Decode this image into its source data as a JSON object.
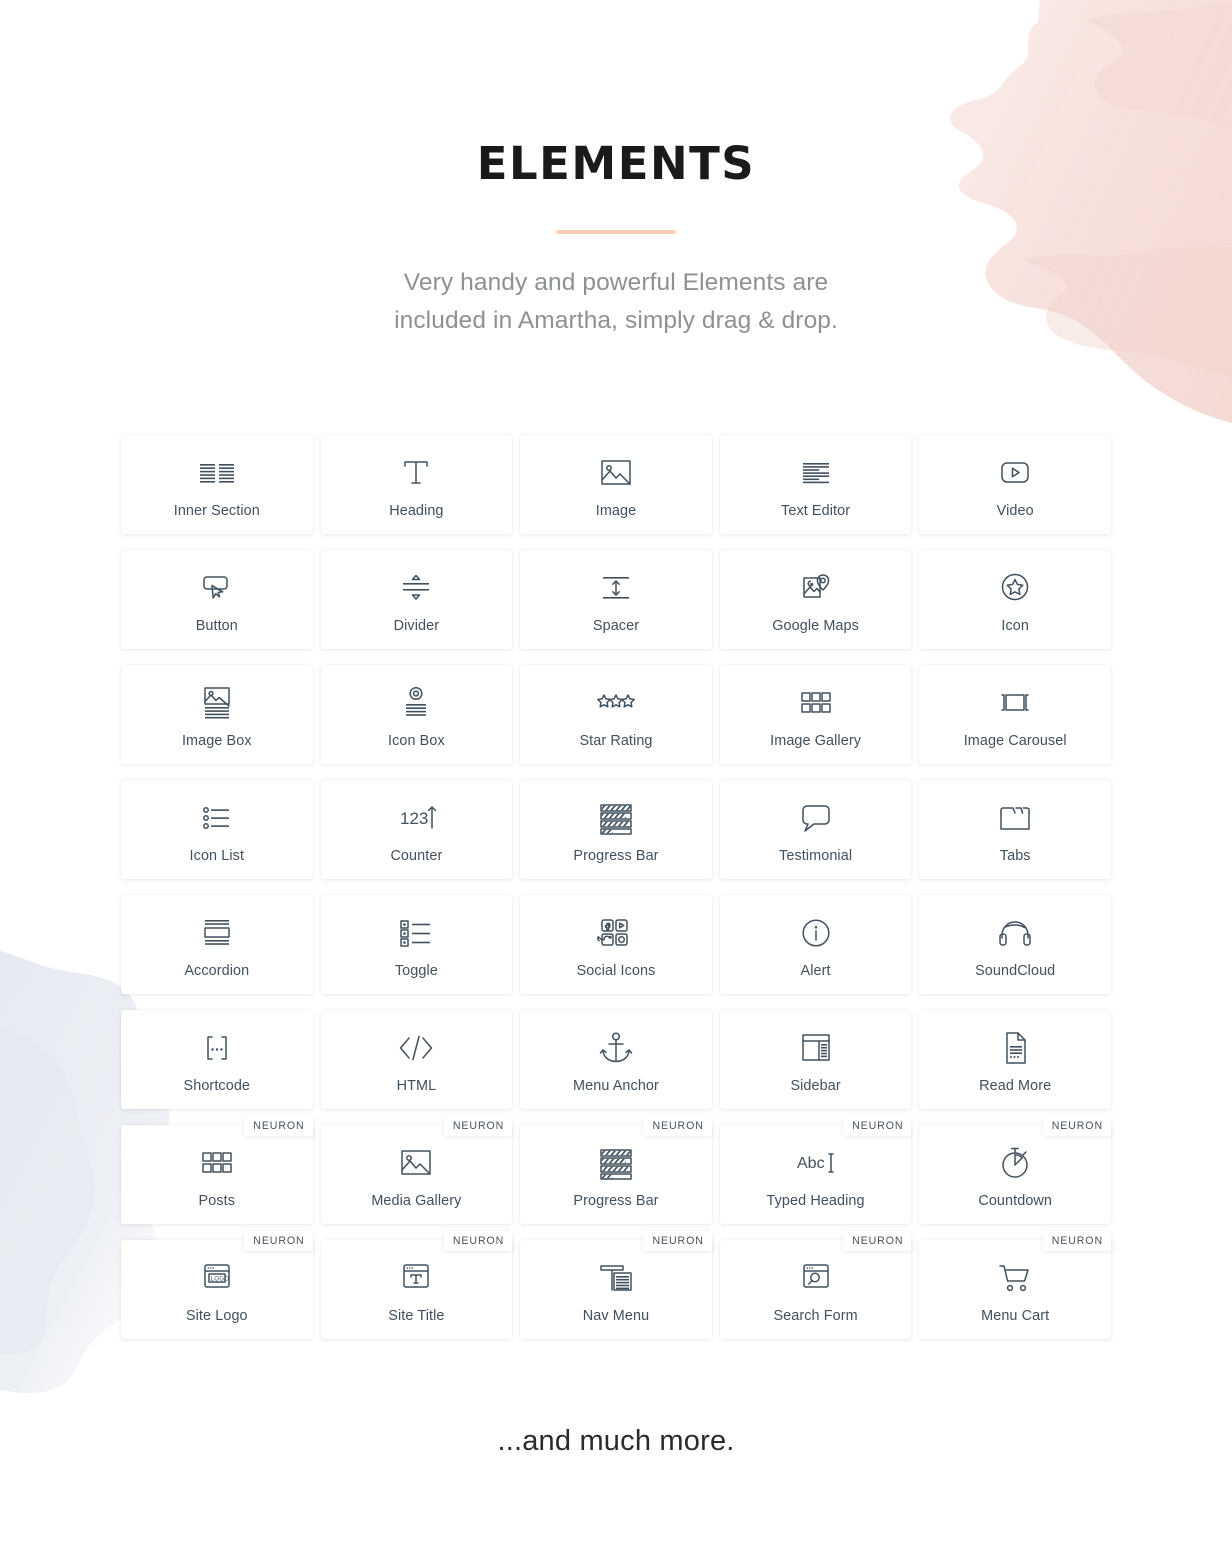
{
  "header": {
    "title": "ELEMENTS",
    "subtitle_line1": "Very handy and powerful Elements are",
    "subtitle_line2": "included in Amartha, simply drag & drop.",
    "accent_color": "#f6cfb4"
  },
  "footer": {
    "text": "...and much more."
  },
  "badge_label": "NEURON",
  "elements": [
    {
      "label": "Inner Section",
      "icon": "inner-section-icon",
      "badge": ""
    },
    {
      "label": "Heading",
      "icon": "heading-icon",
      "badge": ""
    },
    {
      "label": "Image",
      "icon": "image-icon",
      "badge": ""
    },
    {
      "label": "Text Editor",
      "icon": "text-editor-icon",
      "badge": ""
    },
    {
      "label": "Video",
      "icon": "video-icon",
      "badge": ""
    },
    {
      "label": "Button",
      "icon": "button-icon",
      "badge": ""
    },
    {
      "label": "Divider",
      "icon": "divider-icon",
      "badge": ""
    },
    {
      "label": "Spacer",
      "icon": "spacer-icon",
      "badge": ""
    },
    {
      "label": "Google Maps",
      "icon": "google-maps-icon",
      "badge": ""
    },
    {
      "label": "Icon",
      "icon": "star-circle-icon",
      "badge": ""
    },
    {
      "label": "Image Box",
      "icon": "image-box-icon",
      "badge": ""
    },
    {
      "label": "Icon Box",
      "icon": "icon-box-icon",
      "badge": ""
    },
    {
      "label": "Star Rating",
      "icon": "star-rating-icon",
      "badge": ""
    },
    {
      "label": "Image Gallery",
      "icon": "grid-icon",
      "badge": ""
    },
    {
      "label": "Image Carousel",
      "icon": "carousel-icon",
      "badge": ""
    },
    {
      "label": "Icon List",
      "icon": "icon-list-icon",
      "badge": ""
    },
    {
      "label": "Counter",
      "icon": "counter-icon",
      "badge": ""
    },
    {
      "label": "Progress Bar",
      "icon": "progress-bar-icon",
      "badge": ""
    },
    {
      "label": "Testimonial",
      "icon": "speech-bubble-icon",
      "badge": ""
    },
    {
      "label": "Tabs",
      "icon": "tabs-icon",
      "badge": ""
    },
    {
      "label": "Accordion",
      "icon": "accordion-icon",
      "badge": ""
    },
    {
      "label": "Toggle",
      "icon": "toggle-icon",
      "badge": ""
    },
    {
      "label": "Social Icons",
      "icon": "social-icons-icon",
      "badge": ""
    },
    {
      "label": "Alert",
      "icon": "info-circle-icon",
      "badge": ""
    },
    {
      "label": "SoundCloud",
      "icon": "headphones-icon",
      "badge": ""
    },
    {
      "label": "Shortcode",
      "icon": "shortcode-icon",
      "badge": ""
    },
    {
      "label": "HTML",
      "icon": "code-icon",
      "badge": ""
    },
    {
      "label": "Menu Anchor",
      "icon": "anchor-icon",
      "badge": ""
    },
    {
      "label": "Sidebar",
      "icon": "sidebar-icon",
      "badge": ""
    },
    {
      "label": "Read More",
      "icon": "read-more-icon",
      "badge": ""
    },
    {
      "label": "Posts",
      "icon": "grid-icon",
      "badge": "NEURON"
    },
    {
      "label": "Media Gallery",
      "icon": "image-icon",
      "badge": "NEURON"
    },
    {
      "label": "Progress Bar",
      "icon": "progress-bar-icon",
      "badge": "NEURON"
    },
    {
      "label": "Typed Heading",
      "icon": "typed-heading-icon",
      "badge": "NEURON"
    },
    {
      "label": "Countdown",
      "icon": "stopwatch-icon",
      "badge": "NEURON"
    },
    {
      "label": "Site Logo",
      "icon": "site-logo-icon",
      "badge": "NEURON"
    },
    {
      "label": "Site Title",
      "icon": "site-title-icon",
      "badge": "NEURON"
    },
    {
      "label": "Nav Menu",
      "icon": "nav-menu-icon",
      "badge": "NEURON"
    },
    {
      "label": "Search Form",
      "icon": "search-form-icon",
      "badge": "NEURON"
    },
    {
      "label": "Menu Cart",
      "icon": "cart-icon",
      "badge": "NEURON"
    }
  ]
}
